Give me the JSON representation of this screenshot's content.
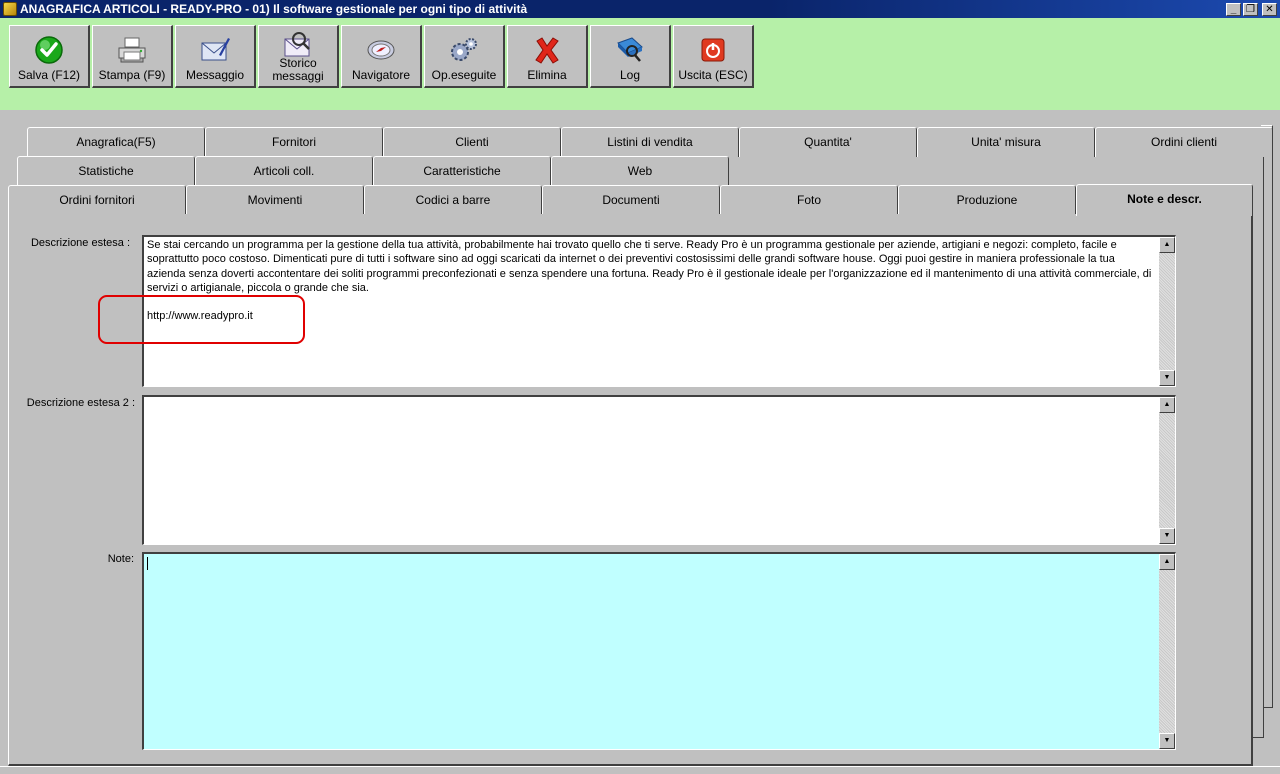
{
  "window": {
    "title": "ANAGRAFICA ARTICOLI - READY-PRO - 01) Il software gestionale per ogni tipo di attività",
    "minimize": "_",
    "restore": "❐",
    "close": "✕"
  },
  "toolbar": {
    "buttons": [
      {
        "label": "Salva (F12)",
        "icon": "save-check-icon"
      },
      {
        "label": "Stampa (F9)",
        "icon": "printer-icon"
      },
      {
        "label": "Messaggio",
        "icon": "message-envelope-icon"
      },
      {
        "label": "Storico\nmessaggi",
        "icon": "message-history-icon"
      },
      {
        "label": "Navigatore",
        "icon": "navigator-compass-icon"
      },
      {
        "label": "Op.eseguite",
        "icon": "gears-icon"
      },
      {
        "label": "Elimina",
        "icon": "delete-x-icon"
      },
      {
        "label": "Log",
        "icon": "log-book-icon"
      },
      {
        "label": "Uscita (ESC)",
        "icon": "power-exit-icon"
      }
    ]
  },
  "tabs": {
    "row1": [
      "Anagrafica(F5)",
      "Fornitori",
      "Clienti",
      "Listini di vendita",
      "Quantita'",
      "Unita' misura",
      "Ordini clienti"
    ],
    "row2": [
      "Statistiche",
      "Articoli coll.",
      "Caratteristiche",
      "Web"
    ],
    "row3": [
      "Ordini fornitori",
      "Movimenti",
      "Codici a barre",
      "Documenti",
      "Foto",
      "Produzione",
      "Note e descr."
    ],
    "active": "Note e descr."
  },
  "form": {
    "desc1_label": "Descrizione estesa :",
    "desc1_value": "Se stai cercando un programma per la gestione della tua attività, probabilmente hai trovato quello che ti serve. Ready Pro è un programma gestionale per aziende, artigiani e negozi: completo, facile e soprattutto poco costoso. Dimenticati pure di tutti i software sino ad oggi scaricati da internet o dei preventivi costosissimi delle grandi software house. Oggi puoi gestire in maniera professionale la tua azienda senza doverti accontentare dei soliti programmi preconfezionati e senza spendere una fortuna. Ready Pro è il gestionale ideale per l'organizzazione ed il mantenimento di una attività commerciale, di servizi o artigianale, piccola o grande che sia.\n\nhttp://www.readypro.it",
    "desc2_label": "Descrizione estesa 2 :",
    "desc2_value": "",
    "note_label": "Note:",
    "note_value": ""
  },
  "colors": {
    "toolbar_bg": "#b6f0a8",
    "note_bg": "#c0ffff",
    "highlight": "#e00000"
  }
}
